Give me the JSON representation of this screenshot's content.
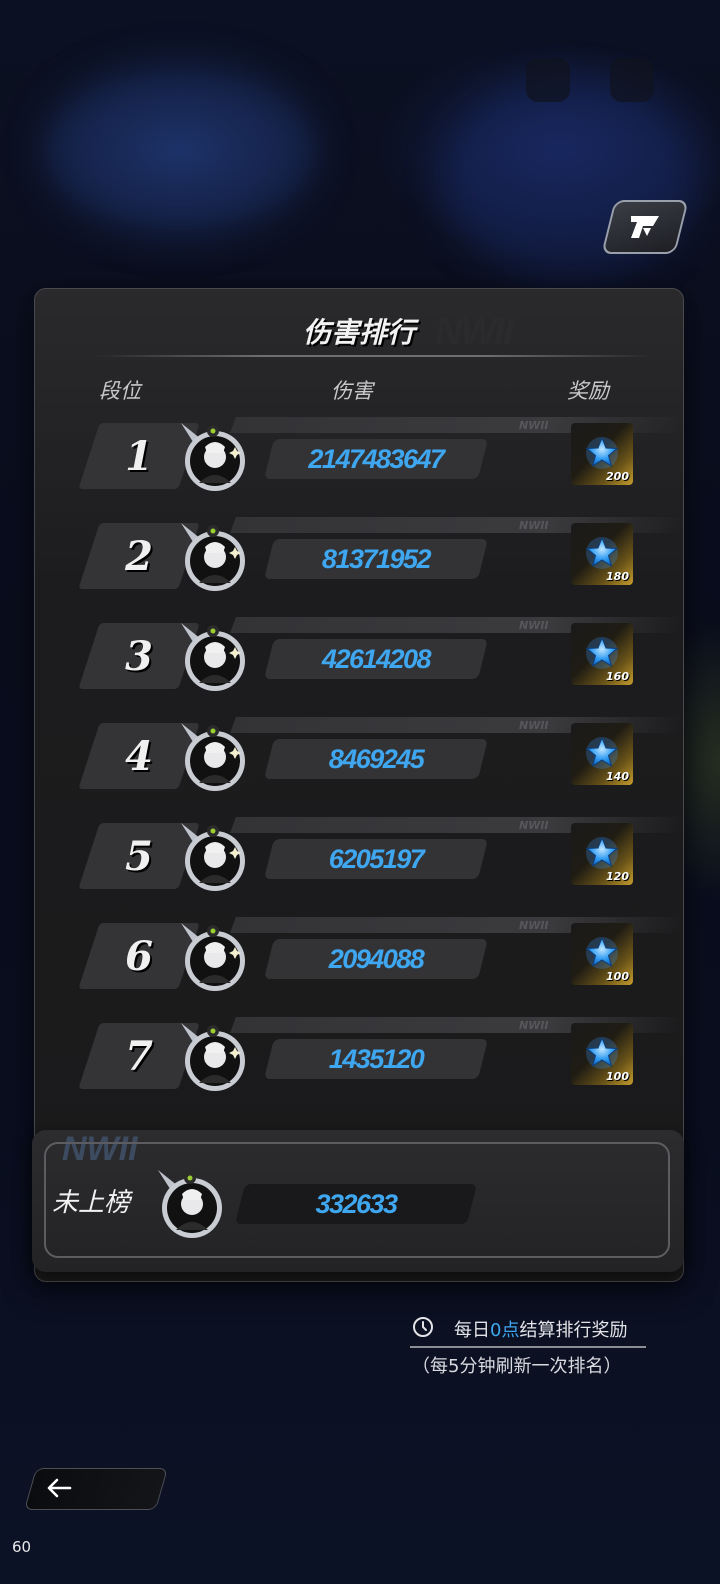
{
  "panel": {
    "title": "伤害排行",
    "headers": {
      "rank": "段位",
      "damage": "伤害",
      "reward": "奖励"
    },
    "rows": [
      {
        "rank": "1",
        "damage": "2147483647",
        "reward": "200"
      },
      {
        "rank": "2",
        "damage": "81371952",
        "reward": "180"
      },
      {
        "rank": "3",
        "damage": "42614208",
        "reward": "160"
      },
      {
        "rank": "4",
        "damage": "8469245",
        "reward": "140"
      },
      {
        "rank": "5",
        "damage": "6205197",
        "reward": "120"
      },
      {
        "rank": "6",
        "damage": "2094088",
        "reward": "100"
      },
      {
        "rank": "7",
        "damage": "1435120",
        "reward": "100"
      }
    ]
  },
  "self": {
    "label": "未上榜",
    "damage": "332633"
  },
  "footer": {
    "settle_prefix": "每日",
    "settle_highlight": "0点",
    "settle_suffix": "结算排行奖励",
    "refresh": "（每5分钟刷新一次排名）"
  },
  "fps": "60",
  "colors": {
    "accent": "#3fa6f0",
    "gold": "#c59c2c",
    "panel": "#1c1c1e"
  },
  "icons": {
    "back": "arrow-left-icon",
    "clock": "clock-icon",
    "reward": "star-icon",
    "logo": "game-logo-icon"
  }
}
